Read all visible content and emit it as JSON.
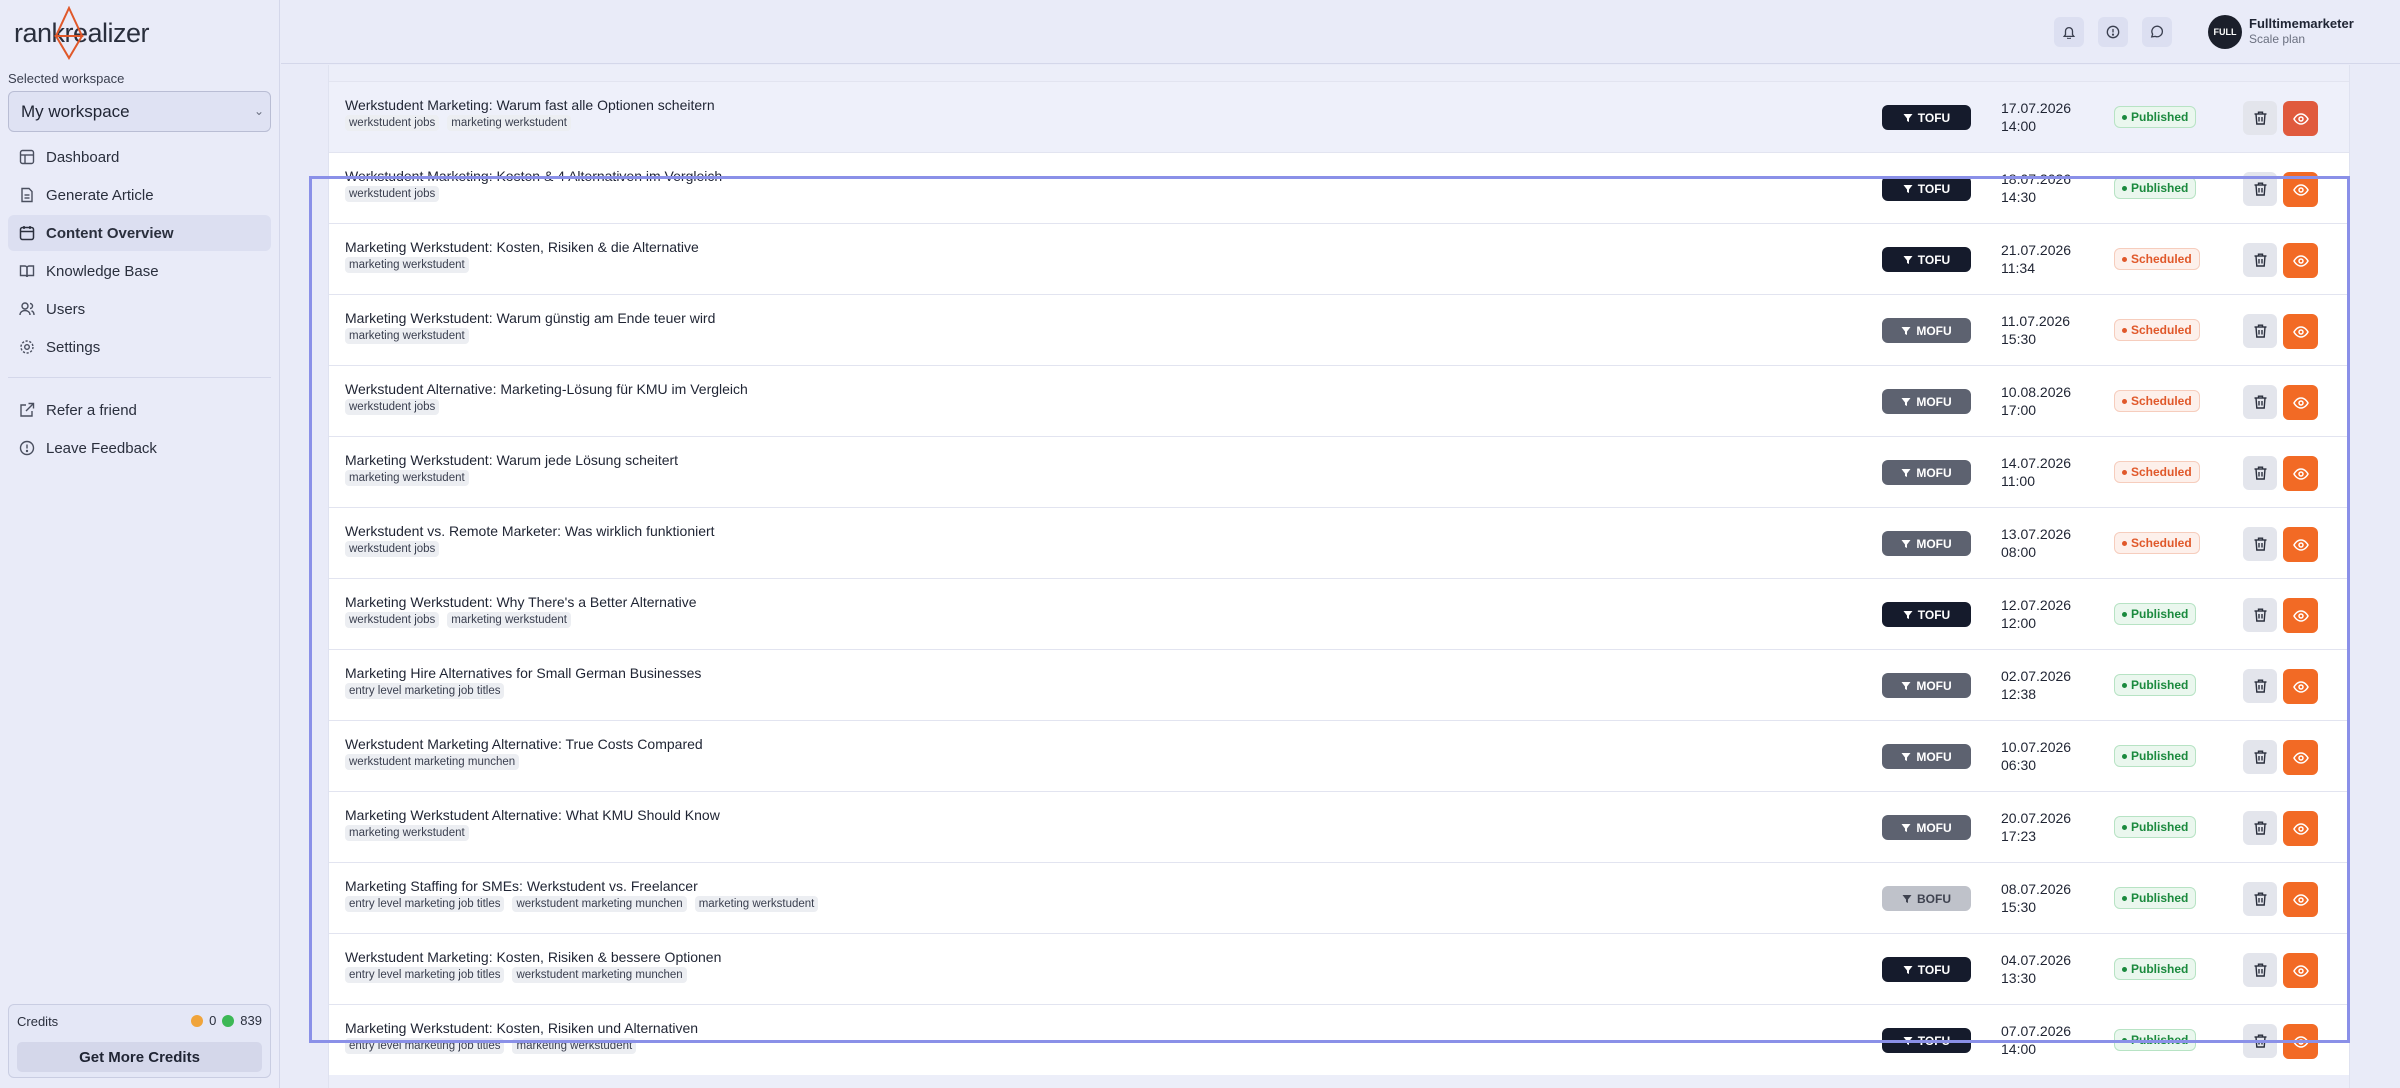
{
  "app": {
    "logo_text": "rankrealizer",
    "brand_color": "#f26a25"
  },
  "sidebar": {
    "workspace_label": "Selected workspace",
    "workspace_value": "My workspace",
    "items": [
      {
        "label": "Dashboard",
        "icon": "dashboard-icon"
      },
      {
        "label": "Generate Article",
        "icon": "document-icon"
      },
      {
        "label": "Content Overview",
        "icon": "calendar-icon",
        "active": true
      },
      {
        "label": "Knowledge Base",
        "icon": "book-icon"
      },
      {
        "label": "Users",
        "icon": "user-icon"
      },
      {
        "label": "Settings",
        "icon": "gear-icon"
      }
    ],
    "secondary": [
      {
        "label": "Refer a friend",
        "icon": "external-link-icon"
      },
      {
        "label": "Leave Feedback",
        "icon": "alert-circle-icon"
      }
    ],
    "credits": {
      "label": "Credits",
      "orange": "0",
      "green": "839",
      "button": "Get More Credits"
    }
  },
  "topbar": {
    "icons": [
      "bell-icon",
      "info-icon",
      "chat-icon"
    ],
    "avatar_text": "FULL",
    "user_name": "Fulltimemarketer",
    "user_plan": "Scale plan"
  },
  "rows": [
    {
      "title": "Werkstudent Marketing: Warum fast alle Optionen scheitern",
      "tags": [
        "werkstudent jobs",
        "marketing werkstudent"
      ],
      "funnel": "TOFU",
      "date": "17.07.2026",
      "time": "14:00",
      "status": "Published"
    },
    {
      "title": "Werkstudent Marketing: Kosten & 4 Alternativen im Vergleich",
      "tags": [
        "werkstudent jobs"
      ],
      "funnel": "TOFU",
      "date": "18.07.2026",
      "time": "14:30",
      "status": "Published"
    },
    {
      "title": "Marketing Werkstudent: Kosten, Risiken & die Alternative",
      "tags": [
        "marketing werkstudent"
      ],
      "funnel": "TOFU",
      "date": "21.07.2026",
      "time": "11:34",
      "status": "Scheduled"
    },
    {
      "title": "Marketing Werkstudent: Warum günstig am Ende teuer wird",
      "tags": [
        "marketing werkstudent"
      ],
      "funnel": "MOFU",
      "date": "11.07.2026",
      "time": "15:30",
      "status": "Scheduled"
    },
    {
      "title": "Werkstudent Alternative: Marketing-Lösung für KMU im Vergleich",
      "tags": [
        "werkstudent jobs"
      ],
      "funnel": "MOFU",
      "date": "10.08.2026",
      "time": "17:00",
      "status": "Scheduled"
    },
    {
      "title": "Marketing Werkstudent: Warum jede Lösung scheitert",
      "tags": [
        "marketing werkstudent"
      ],
      "funnel": "MOFU",
      "date": "14.07.2026",
      "time": "11:00",
      "status": "Scheduled"
    },
    {
      "title": "Werkstudent vs. Remote Marketer: Was wirklich funktioniert",
      "tags": [
        "werkstudent jobs"
      ],
      "funnel": "MOFU",
      "date": "13.07.2026",
      "time": "08:00",
      "status": "Scheduled"
    },
    {
      "title": "Marketing Werkstudent: Why There's a Better Alternative",
      "tags": [
        "werkstudent jobs",
        "marketing werkstudent"
      ],
      "funnel": "TOFU",
      "date": "12.07.2026",
      "time": "12:00",
      "status": "Published"
    },
    {
      "title": "Marketing Hire Alternatives for Small German Businesses",
      "tags": [
        "entry level marketing job titles"
      ],
      "funnel": "MOFU",
      "date": "02.07.2026",
      "time": "12:38",
      "status": "Published"
    },
    {
      "title": "Werkstudent Marketing Alternative: True Costs Compared",
      "tags": [
        "werkstudent marketing munchen"
      ],
      "funnel": "MOFU",
      "date": "10.07.2026",
      "time": "06:30",
      "status": "Published"
    },
    {
      "title": "Marketing Werkstudent Alternative: What KMU Should Know",
      "tags": [
        "marketing werkstudent"
      ],
      "funnel": "MOFU",
      "date": "20.07.2026",
      "time": "17:23",
      "status": "Published"
    },
    {
      "title": "Marketing Staffing for SMEs: Werkstudent vs. Freelancer",
      "tags": [
        "entry level marketing job titles",
        "werkstudent marketing munchen",
        "marketing werkstudent"
      ],
      "funnel": "BOFU",
      "date": "08.07.2026",
      "time": "15:30",
      "status": "Published"
    },
    {
      "title": "Werkstudent Marketing: Kosten, Risiken & bessere Optionen",
      "tags": [
        "entry level marketing job titles",
        "werkstudent marketing munchen"
      ],
      "funnel": "TOFU",
      "date": "04.07.2026",
      "time": "13:30",
      "status": "Published"
    },
    {
      "title": "Marketing Werkstudent: Kosten, Risiken und Alternativen",
      "tags": [
        "entry level marketing job titles",
        "marketing werkstudent"
      ],
      "funnel": "TOFU",
      "date": "07.07.2026",
      "time": "14:00",
      "status": "Published"
    }
  ]
}
